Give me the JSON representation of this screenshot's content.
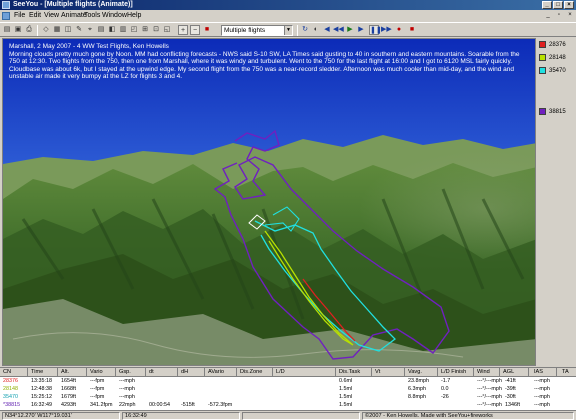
{
  "window": {
    "title": "SeeYou - [Multiple flights (Animate)]",
    "min_glyph": "_",
    "max_glyph": "□",
    "close_glyph": "×"
  },
  "menu": {
    "items": [
      "File",
      "Edit",
      "View",
      "Animate",
      "Tools",
      "Window",
      "Help"
    ],
    "mdi_min": "_",
    "mdi_restore": "▫",
    "mdi_close": "×"
  },
  "toolbar": {
    "flight_select": "Multiple flights",
    "icons": {
      "open": "▤",
      "save": "▣",
      "print": "⎙",
      "zoom_in": "+",
      "zoom_out": "−",
      "stop_red": "■",
      "rotate": "↻",
      "back": "◀",
      "rewind": "◀◀",
      "play": "▶",
      "pause": "❚❚",
      "fast_forward": "▶▶",
      "record": "●",
      "stop": "■"
    }
  },
  "overlay": {
    "heading": "Marshall, 2 May 2007 - 4 WW Test Flights, Ken Howells",
    "body": "Morning clouds pretty much gone by Noon.  MM had conflicting forecasts - NWS said S-10 SW, LA Times said gusting to 40 in southern and eastern mountains. Soarable from the 750 at 12:30. Two flights from the 750, then one from Marshall, where it was windy and turbulent.  Went to the 750 for the last flight  at 16:00 and I got to 6120 MSL fairly quickly.  Cloudbase was about 6k, but I stayed at the upwind edge.  My second flight from the 750 was a near-record sledder. Afternoon was much cooler than mid-day, and the wind and unstable air made it very bumpy at the LZ for flights 3 and 4."
  },
  "legend": [
    {
      "label": "28376",
      "color": "#e02020"
    },
    {
      "label": "28148",
      "color": "#b8e000"
    },
    {
      "label": "35470",
      "color": "#20e0e0"
    },
    {
      "label": "38815",
      "color": "#7020c0"
    }
  ],
  "table": {
    "headers": [
      "CN",
      "Time",
      "Alt.",
      "Vario",
      "Gsp.",
      "dt",
      "dH",
      "AVario",
      "Dis.Zone",
      "L/D",
      "Dis.Task",
      "Vt",
      "Vavg.",
      "L/D Finish",
      "Wind",
      "AGL",
      "IAS",
      "TA"
    ],
    "rows": [
      {
        "cn": "28376",
        "color": "#e02020",
        "cells": [
          "13:35:18",
          "1654ft",
          "---fpm",
          "---mph",
          "",
          "",
          "",
          "",
          "",
          "0.6ml",
          "",
          "23.8mph",
          "-1.7",
          "---°/---mph",
          "-41ft",
          "---mph",
          ""
        ]
      },
      {
        "cn": "28148",
        "color": "#90b000",
        "cells": [
          "12:48:38",
          "1668ft",
          "---fpm",
          "---mph",
          "",
          "",
          "",
          "",
          "",
          "1.5ml",
          "",
          "6.3mph",
          "0.0",
          "---°/---mph",
          "-39ft",
          "---mph",
          ""
        ]
      },
      {
        "cn": "35470",
        "color": "#10a0b0",
        "cells": [
          "15:25:12",
          "1679ft",
          "---fpm",
          "---mph",
          "",
          "",
          "",
          "",
          "",
          "1.5ml",
          "",
          "8.8mph",
          "-26",
          "---°/---mph",
          "-30ft",
          "---mph",
          ""
        ]
      },
      {
        "cn": "*38815",
        "color": "#6020b0",
        "cells": [
          "16:32:49",
          "4293ft",
          "341.2fpm",
          "22mph",
          "00:00:54",
          "-515ft",
          "-572.3fpm",
          "",
          "",
          "1.5ml",
          "",
          "",
          "",
          "---°/---mph",
          "1346ft",
          "---mph",
          ""
        ]
      }
    ]
  },
  "status": {
    "coords": "N34°12.270' W117°19.031'",
    "time": "16:32:49",
    "copyright": "©2007 - Ken Howells. Made with SeeYou+fireworks"
  }
}
